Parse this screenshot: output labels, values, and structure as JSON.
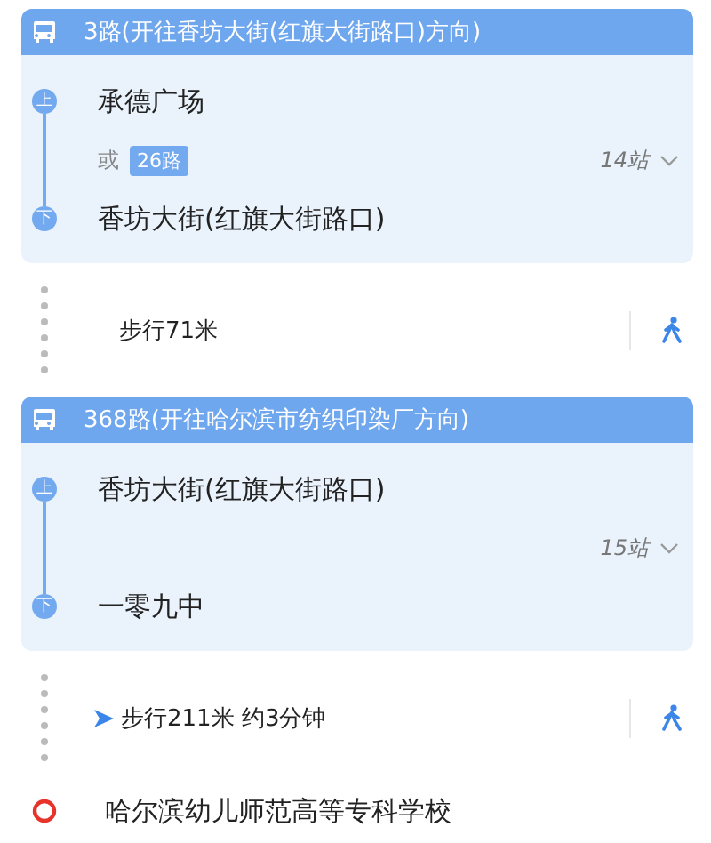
{
  "segments": [
    {
      "kind": "bus",
      "title": "3路(开往香坊大街(红旗大街路口)方向)",
      "board": {
        "marker": "上",
        "stop": "承德广场"
      },
      "alternative": {
        "prefix": "或",
        "route": "26路"
      },
      "stop_count": "14站",
      "alight": {
        "marker": "下",
        "stop": "香坊大街(红旗大街路口)"
      }
    },
    {
      "kind": "walk",
      "text": "步行71米",
      "current": false
    },
    {
      "kind": "bus",
      "title": "368路(开往哈尔滨市纺织印染厂方向)",
      "board": {
        "marker": "上",
        "stop": "香坊大街(红旗大街路口)"
      },
      "stop_count": "15站",
      "alight": {
        "marker": "下",
        "stop": "一零九中"
      }
    },
    {
      "kind": "walk",
      "text": "步行211米 约3分钟",
      "current": true
    }
  ],
  "destination": {
    "name": "哈尔滨幼儿师范高等专科学校"
  }
}
